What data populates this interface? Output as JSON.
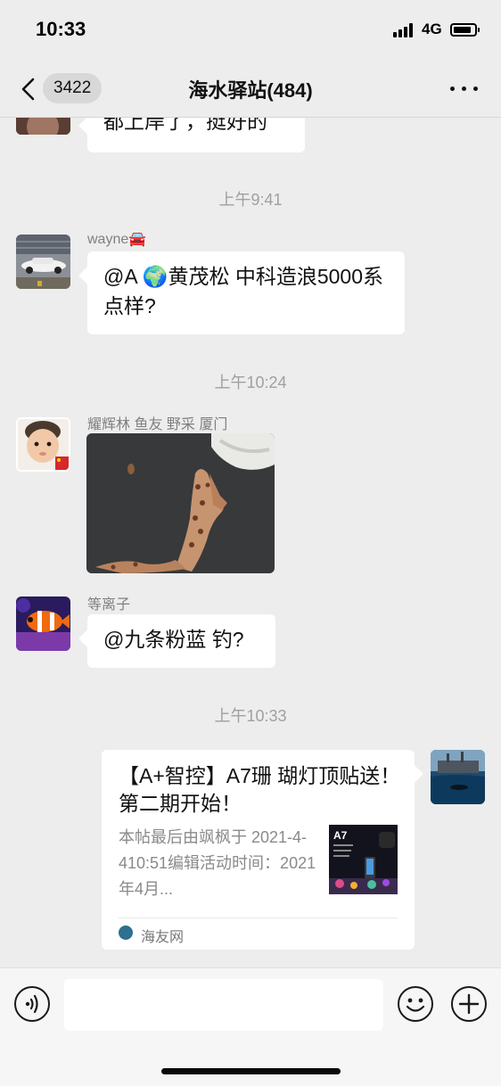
{
  "status_bar": {
    "time": "10:33",
    "network": "4G"
  },
  "nav": {
    "back_badge": "3422",
    "title": "海水驿站(484)"
  },
  "messages": {
    "partial": {
      "text": "都上岸了，挺好的"
    },
    "time_1": "上午9:41",
    "wayne": {
      "sender": "wayne🚘",
      "text": "@A  🌍黄茂松 中科造浪5000系点样?"
    },
    "time_2": "上午10:24",
    "yaohui": {
      "sender": "耀辉林 鱼友 野采 厦门"
    },
    "dengli": {
      "sender": "等离子",
      "text": "@九条粉蓝 钓?"
    },
    "time_3": "上午10:33",
    "link_card": {
      "title": "【A+智控】A7珊 瑚灯顶贴送！第二期开始！",
      "desc": "本帖最后由飒枫于 2021-4-410:51编辑活动时间：2021年4月...",
      "thumb_label": "A7",
      "source": "海友网"
    }
  },
  "input_bar": {
    "voice_icon": "voice-icon",
    "emoji_icon": "emoji-icon",
    "plus_icon": "plus-icon"
  },
  "colors": {
    "background": "#ededed",
    "bubble": "#ffffff",
    "timestamp": "#a0a0a0"
  }
}
